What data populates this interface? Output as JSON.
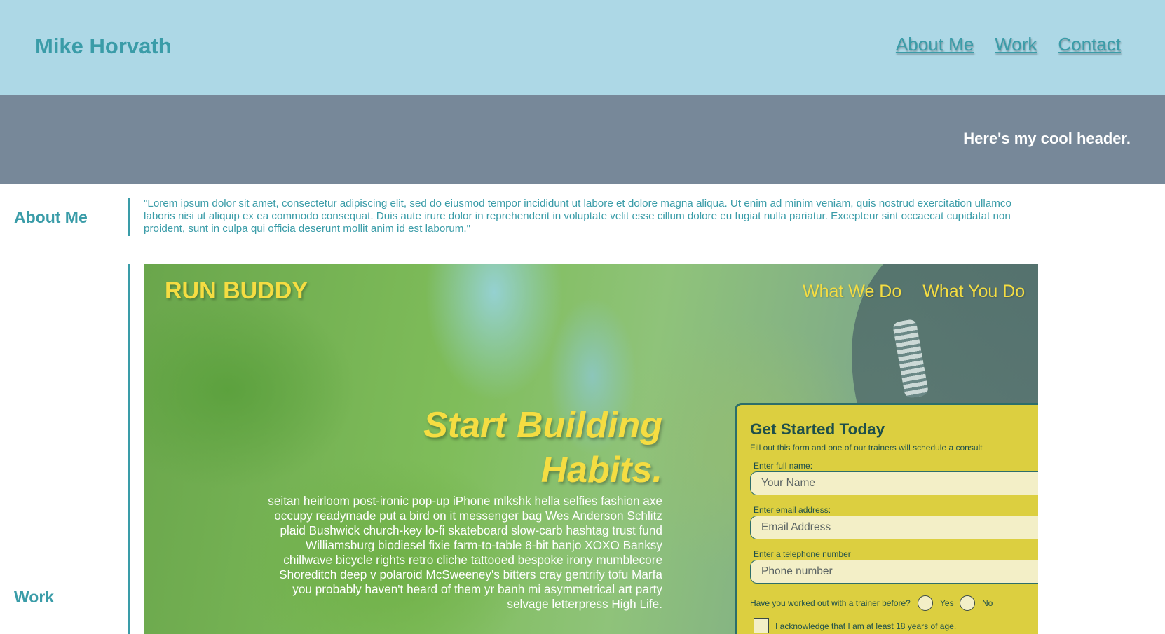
{
  "site": {
    "name": "Mike Horvath"
  },
  "nav": {
    "items": [
      {
        "label": "About Me"
      },
      {
        "label": "Work"
      },
      {
        "label": "Contact"
      }
    ]
  },
  "hero": {
    "text": "Here's my cool header."
  },
  "about": {
    "heading": "About Me",
    "body": "\"Lorem ipsum dolor sit amet, consectetur adipiscing elit, sed do eiusmod tempor incididunt ut labore et dolore magna aliqua. Ut enim ad minim veniam, quis nostrud exercitation ullamco laboris nisi ut aliquip ex ea commodo consequat. Duis aute irure dolor in reprehenderit in voluptate velit esse cillum dolore eu fugiat nulla pariatur. Excepteur sint occaecat cupidatat non proident, sunt in culpa qui officia deserunt mollit anim id est laborum.\""
  },
  "work": {
    "heading": "Work",
    "project": {
      "brand": "RUN BUDDY",
      "nav": [
        {
          "label": "What We Do"
        },
        {
          "label": "What You Do"
        }
      ],
      "title": "Start Building Habits.",
      "copy": "seitan heirloom post-ironic pop-up iPhone mlkshk hella selfies fashion axe occupy readymade put a bird on it messenger bag Wes Anderson Schlitz plaid Bushwick church-key lo-fi skateboard slow-carb hashtag trust fund Williamsburg biodiesel fixie farm-to-table 8-bit banjo XOXO Banksy chillwave bicycle rights retro cliche tattooed bespoke irony mumblecore Shoreditch deep v polaroid McSweeney's bitters cray gentrify tofu Marfa you probably haven't heard of them yr banh mi asymmetrical art party selvage letterpress High Life.",
      "form": {
        "title": "Get Started Today",
        "subtitle": "Fill out this form and one of our trainers will schedule a consult",
        "name_label": "Enter full name:",
        "name_placeholder": "Your Name",
        "email_label": "Enter email address:",
        "email_placeholder": "Email Address",
        "phone_label": "Enter a telephone number",
        "phone_placeholder": "Phone number",
        "trainer_question": "Have you worked out with a trainer before?",
        "yes_label": "Yes",
        "no_label": "No",
        "age_ack": "I acknowledge that I am at least 18 years of age."
      }
    }
  },
  "colors": {
    "nav_bg": "#add8e6",
    "accent": "#3a9ca8",
    "hero_bg": "#778899",
    "project_yellow": "#f5dd42",
    "form_bg": "#dccf40"
  }
}
